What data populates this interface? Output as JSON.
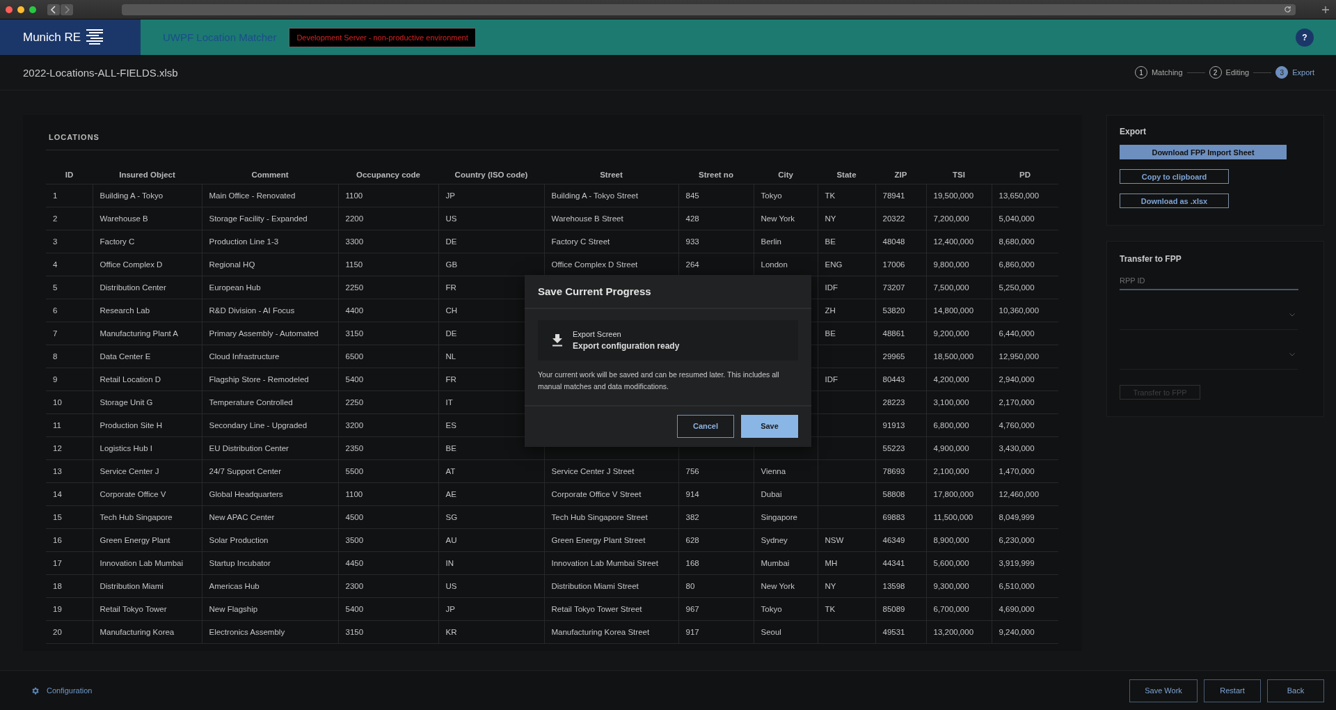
{
  "header": {
    "logo_text": "Munich RE",
    "app_title": "UWPF Location Matcher",
    "environment_badge": "Development Server - non-productive environment",
    "help_button": "?"
  },
  "file_name": "2022-Locations-ALL-FIELDS.xlsb",
  "steps": [
    {
      "number": "1",
      "label": "Matching",
      "selected": false
    },
    {
      "number": "2",
      "label": "Editing",
      "selected": false
    },
    {
      "number": "3",
      "label": "Export",
      "selected": true
    }
  ],
  "locations": {
    "title": "LOCATIONS",
    "columns": [
      "ID",
      "Insured Object",
      "Comment",
      "Occupancy code",
      "Country (ISO code)",
      "Street",
      "Street no",
      "City",
      "State",
      "ZIP",
      "TSI",
      "PD"
    ],
    "rows": [
      {
        "id": "1",
        "insured_object": "Building A - Tokyo",
        "comment": "Main Office - Renovated",
        "occupancy_code": "1100",
        "country": "JP",
        "street": "Building A - Tokyo Street",
        "street_no": "845",
        "city": "Tokyo",
        "state": "TK",
        "zip": "78941",
        "tsi": "19,500,000",
        "pd": "13,650,000"
      },
      {
        "id": "2",
        "insured_object": "Warehouse B",
        "comment": "Storage Facility - Expanded",
        "occupancy_code": "2200",
        "country": "US",
        "street": "Warehouse B Street",
        "street_no": "428",
        "city": "New York",
        "state": "NY",
        "zip": "20322",
        "tsi": "7,200,000",
        "pd": "5,040,000"
      },
      {
        "id": "3",
        "insured_object": "Factory C",
        "comment": "Production Line 1-3",
        "occupancy_code": "3300",
        "country": "DE",
        "street": "Factory C Street",
        "street_no": "933",
        "city": "Berlin",
        "state": "BE",
        "zip": "48048",
        "tsi": "12,400,000",
        "pd": "8,680,000"
      },
      {
        "id": "4",
        "insured_object": "Office Complex D",
        "comment": "Regional HQ",
        "occupancy_code": "1150",
        "country": "GB",
        "street": "Office Complex D Street",
        "street_no": "264",
        "city": "London",
        "state": "ENG",
        "zip": "17006",
        "tsi": "9,800,000",
        "pd": "6,860,000"
      },
      {
        "id": "5",
        "insured_object": "Distribution Center",
        "comment": "European Hub",
        "occupancy_code": "2250",
        "country": "FR",
        "state": "IDF",
        "zip": "73207",
        "tsi": "7,500,000",
        "pd": "5,250,000"
      },
      {
        "id": "6",
        "insured_object": "Research Lab",
        "comment": "R&D Division - AI Focus",
        "occupancy_code": "4400",
        "country": "CH",
        "state": "ZH",
        "zip": "53820",
        "tsi": "14,800,000",
        "pd": "10,360,000"
      },
      {
        "id": "7",
        "insured_object": "Manufacturing Plant A",
        "comment": "Primary Assembly - Automated",
        "occupancy_code": "3150",
        "country": "DE",
        "state": "BE",
        "zip": "48861",
        "tsi": "9,200,000",
        "pd": "6,440,000"
      },
      {
        "id": "8",
        "insured_object": "Data Center E",
        "comment": "Cloud Infrastructure",
        "occupancy_code": "6500",
        "country": "NL",
        "zip": "29965",
        "tsi": "18,500,000",
        "pd": "12,950,000"
      },
      {
        "id": "9",
        "insured_object": "Retail Location D",
        "comment": "Flagship Store - Remodeled",
        "occupancy_code": "5400",
        "country": "FR",
        "state": "IDF",
        "zip": "80443",
        "tsi": "4,200,000",
        "pd": "2,940,000"
      },
      {
        "id": "10",
        "insured_object": "Storage Unit G",
        "comment": "Temperature Controlled",
        "occupancy_code": "2250",
        "country": "IT",
        "zip": "28223",
        "tsi": "3,100,000",
        "pd": "2,170,000"
      },
      {
        "id": "11",
        "insured_object": "Production Site H",
        "comment": "Secondary Line - Upgraded",
        "occupancy_code": "3200",
        "country": "ES",
        "zip": "91913",
        "tsi": "6,800,000",
        "pd": "4,760,000"
      },
      {
        "id": "12",
        "insured_object": "Logistics Hub I",
        "comment": "EU Distribution Center",
        "occupancy_code": "2350",
        "country": "BE",
        "zip": "55223",
        "tsi": "4,900,000",
        "pd": "3,430,000"
      },
      {
        "id": "13",
        "insured_object": "Service Center J",
        "comment": "24/7 Support Center",
        "occupancy_code": "5500",
        "country": "AT",
        "street": "Service Center J Street",
        "street_no": "756",
        "city": "Vienna",
        "zip": "78693",
        "tsi": "2,100,000",
        "pd": "1,470,000"
      },
      {
        "id": "14",
        "insured_object": "Corporate Office V",
        "comment": "Global Headquarters",
        "occupancy_code": "1100",
        "country": "AE",
        "street": "Corporate Office V Street",
        "street_no": "914",
        "city": "Dubai",
        "zip": "58808",
        "tsi": "17,800,000",
        "pd": "12,460,000"
      },
      {
        "id": "15",
        "insured_object": "Tech Hub Singapore",
        "comment": "New APAC Center",
        "occupancy_code": "4500",
        "country": "SG",
        "street": "Tech Hub Singapore Street",
        "street_no": "382",
        "city": "Singapore",
        "zip": "69883",
        "tsi": "11,500,000",
        "pd": "8,049,999"
      },
      {
        "id": "16",
        "insured_object": "Green Energy Plant",
        "comment": "Solar Production",
        "occupancy_code": "3500",
        "country": "AU",
        "street": "Green Energy Plant Street",
        "street_no": "628",
        "city": "Sydney",
        "state": "NSW",
        "zip": "46349",
        "tsi": "8,900,000",
        "pd": "6,230,000"
      },
      {
        "id": "17",
        "insured_object": "Innovation Lab Mumbai",
        "comment": "Startup Incubator",
        "occupancy_code": "4450",
        "country": "IN",
        "street": "Innovation Lab Mumbai Street",
        "street_no": "168",
        "city": "Mumbai",
        "state": "MH",
        "zip": "44341",
        "tsi": "5,600,000",
        "pd": "3,919,999"
      },
      {
        "id": "18",
        "insured_object": "Distribution Miami",
        "comment": "Americas Hub",
        "occupancy_code": "2300",
        "country": "US",
        "street": "Distribution Miami Street",
        "street_no": "80",
        "city": "New York",
        "state": "NY",
        "zip": "13598",
        "tsi": "9,300,000",
        "pd": "6,510,000"
      },
      {
        "id": "19",
        "insured_object": "Retail Tokyo Tower",
        "comment": "New Flagship",
        "occupancy_code": "5400",
        "country": "JP",
        "street": "Retail Tokyo Tower Street",
        "street_no": "967",
        "city": "Tokyo",
        "state": "TK",
        "zip": "85089",
        "tsi": "6,700,000",
        "pd": "4,690,000"
      },
      {
        "id": "20",
        "insured_object": "Manufacturing Korea",
        "comment": "Electronics Assembly",
        "occupancy_code": "3150",
        "country": "KR",
        "street": "Manufacturing Korea Street",
        "street_no": "917",
        "city": "Seoul",
        "zip": "49531",
        "tsi": "13,200,000",
        "pd": "9,240,000"
      }
    ]
  },
  "export_panel": {
    "title": "Export",
    "buttons": [
      {
        "label": "Download FPP Import Sheet",
        "kind": "primary"
      },
      {
        "label": "Copy to clipboard",
        "kind": "outline"
      },
      {
        "label": "Download as .xlsx",
        "kind": "outline"
      }
    ]
  },
  "transfer_panel": {
    "title": "Transfer to FPP",
    "field": {
      "placeholder": "RPP ID"
    },
    "dropdowns": [
      {
        "kind": "select"
      },
      {
        "kind": "select"
      }
    ],
    "button": {
      "label": "Transfer to FPP",
      "disabled": true
    }
  },
  "dialog": {
    "title": "Save Current Progress",
    "item": {
      "label": "Export Screen",
      "detail": "Export configuration ready"
    },
    "message": "Your current work will be saved and can be resumed later. This includes all manual matches and data modifications.",
    "buttons": [
      {
        "label": "Cancel",
        "kind": "secondary"
      },
      {
        "label": "Save",
        "kind": "primary"
      }
    ]
  },
  "footer": {
    "configuration_link": "Configuration",
    "buttons": [
      "Save Work",
      "Restart",
      "Back"
    ]
  }
}
